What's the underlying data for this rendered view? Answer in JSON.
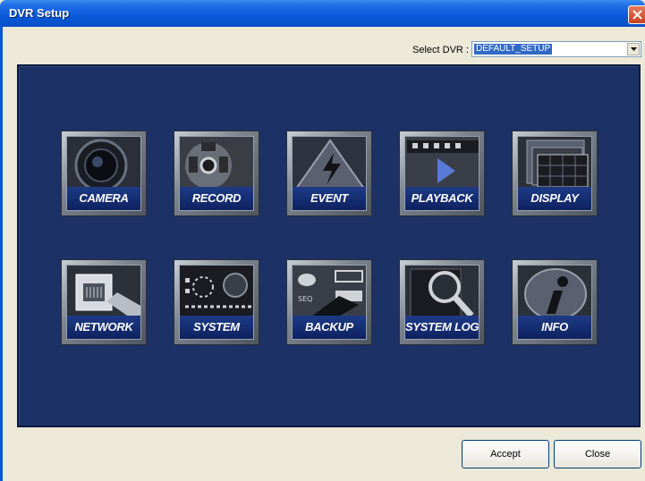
{
  "window": {
    "title": "DVR Setup"
  },
  "dvr_select": {
    "label": "Select DVR :",
    "value": "DEFAULT_SETUP"
  },
  "menu": [
    {
      "label": "CAMERA",
      "icon": "camera-lens-icon"
    },
    {
      "label": "RECORD",
      "icon": "film-reel-icon"
    },
    {
      "label": "EVENT",
      "icon": "warning-bolt-icon"
    },
    {
      "label": "PLAYBACK",
      "icon": "play-film-icon"
    },
    {
      "label": "DISPLAY",
      "icon": "monitor-grid-icon"
    },
    {
      "label": "NETWORK",
      "icon": "ethernet-plug-icon"
    },
    {
      "label": "SYSTEM",
      "icon": "dvr-panel-icon"
    },
    {
      "label": "BACKUP",
      "icon": "usb-drive-icon"
    },
    {
      "label": "SYSTEM LOG",
      "icon": "magnifier-icon"
    },
    {
      "label": "INFO",
      "icon": "info-icon"
    }
  ],
  "buttons": {
    "accept": "Accept",
    "close": "Close"
  }
}
